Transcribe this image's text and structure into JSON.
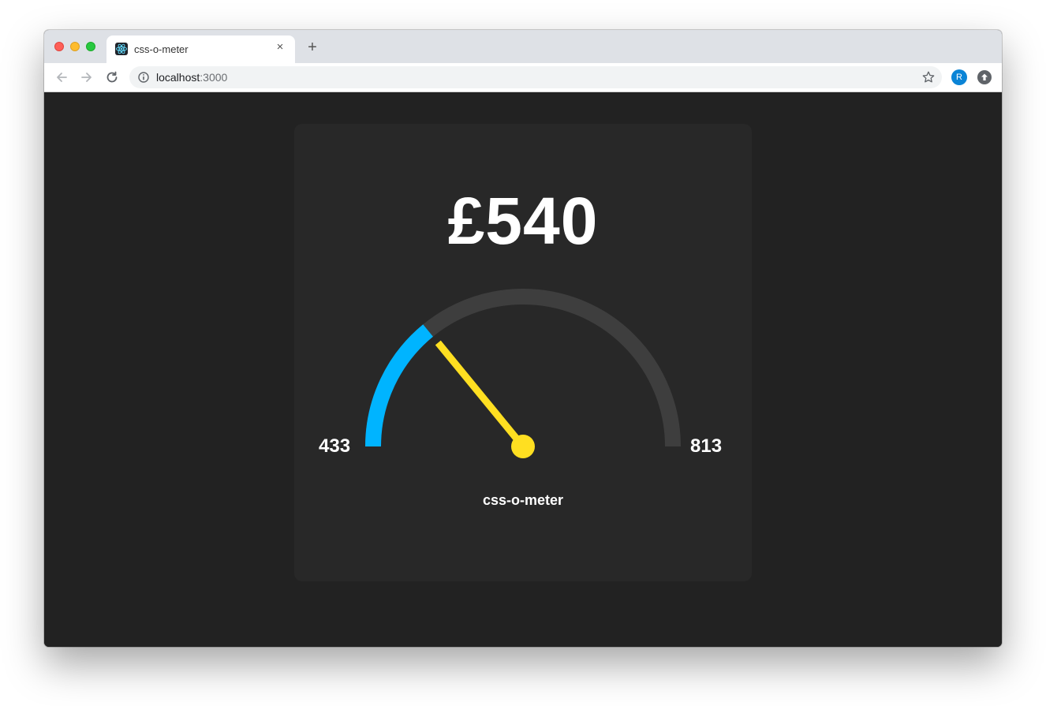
{
  "browser": {
    "tab": {
      "title": "css-o-meter",
      "close": "×"
    },
    "new_tab": "+",
    "url": {
      "host": "localhost",
      "port": ":3000"
    },
    "profile_initial": "R"
  },
  "meter": {
    "value_text": "£540",
    "value": 540,
    "min": 433,
    "max": 813,
    "name": "css-o-meter",
    "colors": {
      "track": "#3e3e3e",
      "fill": "#00b4ff",
      "needle": "#ffdf21"
    }
  },
  "icons": [
    "back-arrow-icon",
    "forward-arrow-icon",
    "reload-icon",
    "info-icon",
    "star-icon",
    "extension-icon",
    "react-icon"
  ]
}
